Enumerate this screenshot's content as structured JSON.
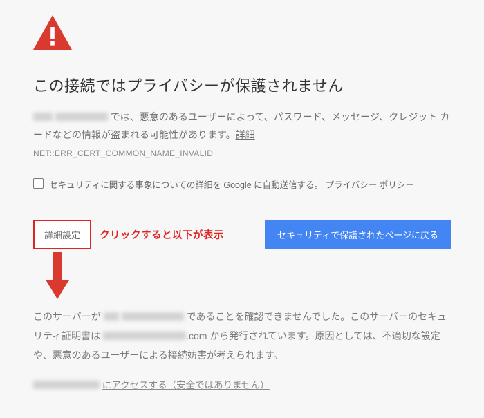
{
  "heading": "この接続ではプライバシーが保護されません",
  "desc": {
    "part1": " では、悪意のあるユーザーによって、パスワード、メッセージ、クレジット カードなどの情報が盗まれる可能性があります。",
    "learn_more": "詳細"
  },
  "error_code": "NET::ERR_CERT_COMMON_NAME_INVALID",
  "optin": {
    "pre": "セキュリティに関する事象についての詳細を Google に",
    "auto_send": "自動送信",
    "post": "する。",
    "privacy": "プライバシー ポリシー"
  },
  "buttons": {
    "advanced": "詳細設定",
    "back_to_safety": "セキュリティで保護されたページに戻る"
  },
  "annotation": "クリックすると以下が表示",
  "details": {
    "p1a": "このサーバーが ",
    "p1b": " であることを確認できませんでした。このサーバーのセキュリティ証明書は ",
    "p1c": ".com から発行されています。原因としては、不適切な設定や、悪意のあるユーザーによる接続妨害が考えられます。"
  },
  "proceed": {
    "text": " にアクセスする（安全ではありません）"
  }
}
